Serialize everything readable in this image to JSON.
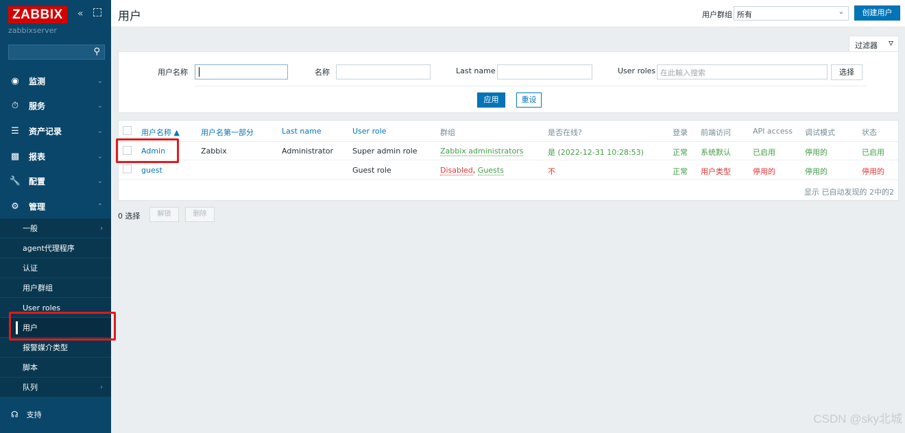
{
  "sidebar": {
    "logo": "ZABBIX",
    "collapse_glyph": "«",
    "server_name": "zabbixserver",
    "search_icon": "search-icon",
    "menu": [
      {
        "label": "监测",
        "icon": "eye-icon"
      },
      {
        "label": "服务",
        "icon": "clock-icon"
      },
      {
        "label": "资产记录",
        "icon": "list-icon"
      },
      {
        "label": "报表",
        "icon": "bar-chart-icon"
      },
      {
        "label": "配置",
        "icon": "wrench-icon"
      },
      {
        "label": "管理",
        "icon": "gear-icon"
      }
    ],
    "admin_submenu": [
      {
        "label": "一般"
      },
      {
        "label": "agent代理程序"
      },
      {
        "label": "认证"
      },
      {
        "label": "用户群组"
      },
      {
        "label": "User roles"
      },
      {
        "label": "用户"
      },
      {
        "label": "报警媒介类型"
      },
      {
        "label": "脚本"
      },
      {
        "label": "队列"
      }
    ],
    "active_item": "用户",
    "support_label": "支持"
  },
  "header": {
    "title": "用户",
    "group_label": "用户群组",
    "group_value": "所有",
    "create_button": "创建用户"
  },
  "filter": {
    "tab_label": "过滤器",
    "username_label": "用户名称",
    "username_value": "",
    "name_label": "名称",
    "name_value": "",
    "lastname_label": "Last name",
    "lastname_value": "",
    "roles_label": "User roles",
    "roles_placeholder": "在此輸入搜索",
    "select_button": "选择",
    "apply_button": "应用",
    "reset_button": "重设"
  },
  "table": {
    "columns": [
      "用户名称 ▲",
      "用户名第一部分",
      "Last name",
      "User role",
      "群组",
      "是否在线?",
      "登录",
      "前端访问",
      "API access",
      "调试模式",
      "状态"
    ],
    "rows": [
      {
        "username": "Admin",
        "first_name": "Zabbix",
        "last_name": "Administrator",
        "role": "Super admin role",
        "groups": [
          "Zabbix administrators"
        ],
        "online": "是 (2022-12-31 10:28:53)",
        "login": "正常",
        "frontend": "系统默认",
        "api": "已启用",
        "debug": "停用的",
        "status": "已启用"
      },
      {
        "username": "guest",
        "first_name": "",
        "last_name": "",
        "role": "Guest role",
        "groups": [
          "Disabled",
          "Guests"
        ],
        "group_sep": ",",
        "online": "不",
        "login": "正常",
        "frontend": "用户类型",
        "api": "停用的",
        "debug": "停用的",
        "status": "停用的"
      }
    ],
    "footer": "显示 已自动发现的 2中的2"
  },
  "actions": {
    "selected_count": "0 选择",
    "unblock_button": "解锁",
    "delete_button": "删除"
  },
  "watermark": "CSDN @sky北城",
  "colors": {
    "sidebar": "#0a466a",
    "brand_red": "#d40000",
    "primary": "#0275b8",
    "ok_green": "#429e47",
    "alert_red": "#e33734",
    "highlight_box": "#e11a1a"
  }
}
